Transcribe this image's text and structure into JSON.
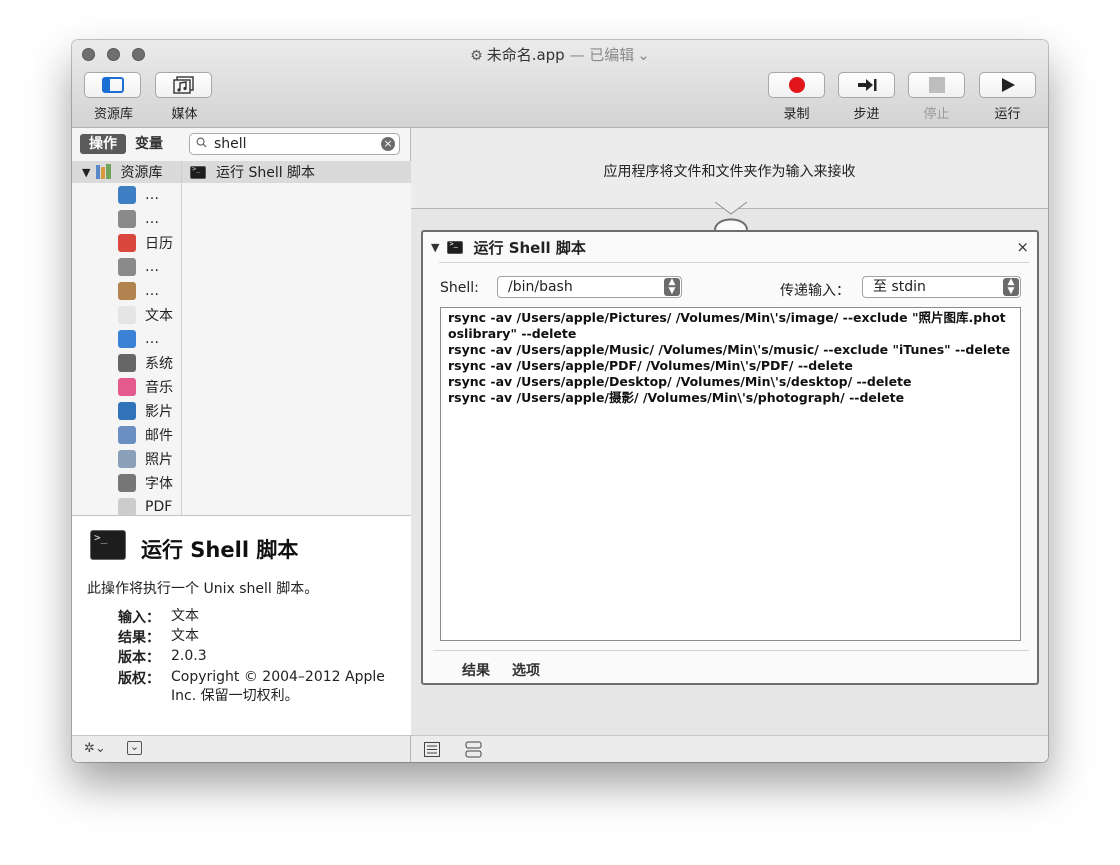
{
  "window": {
    "title": "未命名.app",
    "title_sep": " — ",
    "edited": "已编辑",
    "edited_chevron": "⌄"
  },
  "toolbar": {
    "library_label": "资源库",
    "media_label": "媒体",
    "record_label": "录制",
    "step_label": "步进",
    "stop_label": "停止",
    "run_label": "运行",
    "record_color": "#e0161a"
  },
  "left_pane": {
    "tabs": [
      "操作",
      "变量"
    ],
    "search": {
      "value": "shell",
      "placeholder": ""
    },
    "library_header": "资源库",
    "library_items": [
      {
        "label": "…",
        "icon": "safari-icon",
        "color": "#3d7fc2"
      },
      {
        "label": "…",
        "icon": "developer-tools-icon",
        "color": "#8a8a8a"
      },
      {
        "label": "日历",
        "icon": "calendar-icon",
        "color": "#d9473f"
      },
      {
        "label": "…",
        "icon": "utilities-icon",
        "color": "#8a8a8a"
      },
      {
        "label": "…",
        "icon": "contacts-icon",
        "color": "#b3834f"
      },
      {
        "label": "文本",
        "icon": "text-icon",
        "color": "#e5e5e5"
      },
      {
        "label": "…",
        "icon": "finder-icon",
        "color": "#3b82d6"
      },
      {
        "label": "系统",
        "icon": "system-icon",
        "color": "#666666"
      },
      {
        "label": "音乐",
        "icon": "music-icon",
        "color": "#e45a8c"
      },
      {
        "label": "影片",
        "icon": "movies-icon",
        "color": "#3173b8"
      },
      {
        "label": "邮件",
        "icon": "mail-icon",
        "color": "#6b8fc0"
      },
      {
        "label": "照片",
        "icon": "photos-icon",
        "color": "#8aa0b8"
      },
      {
        "label": "字体",
        "icon": "fonts-icon",
        "color": "#777777"
      },
      {
        "label": "PDF",
        "icon": "pdf-icon",
        "color": "#cccccc"
      }
    ],
    "action_result": "运行 Shell 脚本"
  },
  "description": {
    "title": "运行 Shell 脚本",
    "text": "此操作将执行一个 Unix shell 脚本。",
    "input_key": "输入：",
    "input_val": "文本",
    "result_key": "结果：",
    "result_val": "文本",
    "version_key": "版本：",
    "version_val": "2.0.3",
    "copyright_key": "版权：",
    "copyright_val": "Copyright © 2004–2012 Apple Inc. 保留一切权利。"
  },
  "workflow": {
    "input_text": "应用程序将文件和文件夹作为输入来接收",
    "action": {
      "title": "运行 Shell 脚本",
      "close": "×",
      "shell_label": "Shell:",
      "shell_value": "/bin/bash",
      "pass_input_label": "传递输入：",
      "pass_input_value": "至 stdin",
      "script_lines": [
        "rsync -av /Users/apple/Pictures/ /Volumes/Min\\'s/image/ --exclude \"照片图库.photoslibrary\" --delete",
        "rsync -av /Users/apple/Music/ /Volumes/Min\\'s/music/ --exclude \"iTunes\" --delete",
        "rsync -av /Users/apple/PDF/ /Volumes/Min\\'s/PDF/ --delete",
        "rsync -av /Users/apple/Desktop/ /Volumes/Min\\'s/desktop/ --delete",
        "rsync -av /Users/apple/摄影/ /Volumes/Min\\'s/photograph/ --delete"
      ],
      "tab_results": "结果",
      "tab_options": "选项"
    }
  },
  "bottom": {
    "gear": "✲⌄",
    "collapse": "⌄"
  }
}
